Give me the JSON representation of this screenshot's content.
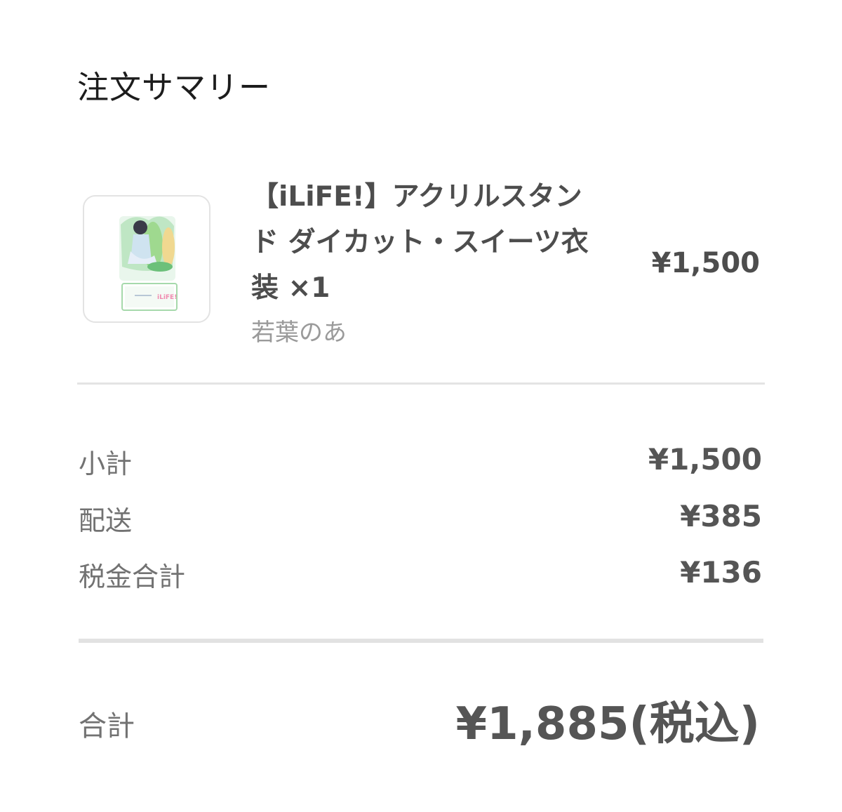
{
  "summary": {
    "title": "注文サマリー"
  },
  "item": {
    "name": "【iLiFE!】アクリルスタンド ダイカット・スイーツ衣装 ×1",
    "vendor": "若葉のあ",
    "price": "¥1,500",
    "thumbnail_icon": "acrylic-stand-image",
    "thumbnail_logo_text": "iLiFE!"
  },
  "costs": [
    {
      "label": "小計",
      "value": "¥1,500"
    },
    {
      "label": "配送",
      "value": "¥385"
    },
    {
      "label": "税金合計",
      "value": "¥136"
    }
  ],
  "total": {
    "label": "合計",
    "value": "¥1,885(税込)"
  },
  "colors": {
    "text_dark": "#1c1c1c",
    "text_value": "#555555",
    "text_label": "#727272",
    "text_muted": "#9a9a9a",
    "divider": "#e4e4e4",
    "thumb_accent": "#7fd08a"
  }
}
